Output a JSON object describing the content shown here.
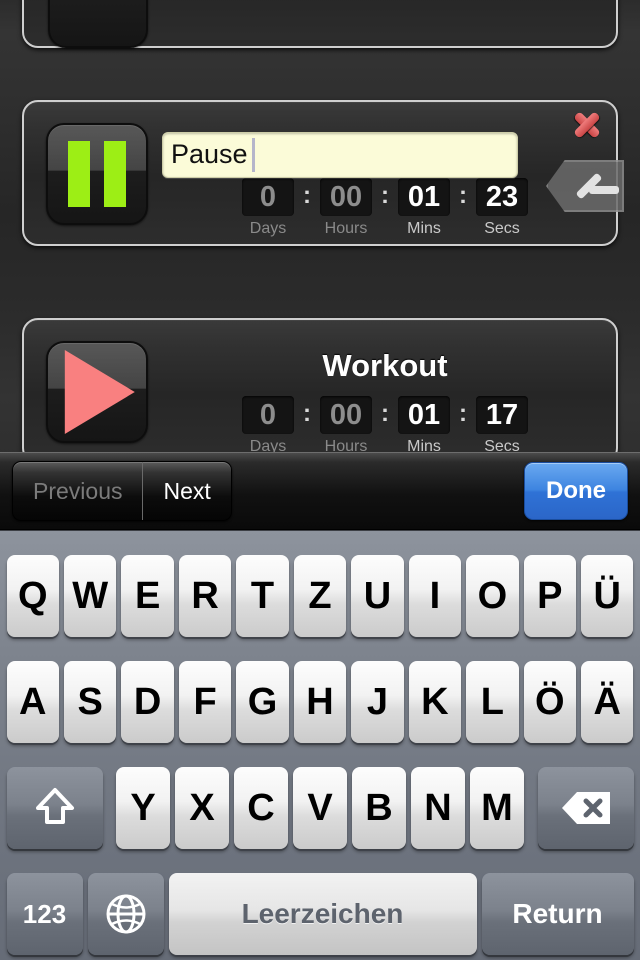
{
  "app": {
    "background_color": "#2a2a2a",
    "accent_green": "#9dee15",
    "accent_salmon": "#f98080",
    "accent_blue": "#3d84e0",
    "field_color": "#fbfbd8"
  },
  "timer_labels": {
    "days": "Days",
    "hours": "Hours",
    "mins": "Mins",
    "secs": "Secs"
  },
  "cards": [
    {
      "id": "card-cut-top",
      "title": "",
      "state_icon": "pause-icon",
      "visible": "partial",
      "time": {
        "days": "",
        "hours": "",
        "mins": "",
        "secs": ""
      }
    },
    {
      "id": "card-pause",
      "title": "Pause",
      "state_icon": "pause-icon",
      "editing": true,
      "input_value": "Pause",
      "input_placeholder": "",
      "time": {
        "days": "0",
        "hours": "00",
        "mins": "01",
        "secs": "23"
      },
      "delete_label": "×",
      "clear_label": "×"
    },
    {
      "id": "card-workout",
      "title": "Workout",
      "state_icon": "play-icon",
      "editing": false,
      "time": {
        "days": "0",
        "hours": "00",
        "mins": "01",
        "secs": "17"
      }
    }
  ],
  "accessory_toolbar": {
    "previous_label": "Previous",
    "previous_enabled": false,
    "next_label": "Next",
    "next_enabled": true,
    "done_label": "Done"
  },
  "keyboard": {
    "language": "German (QWERTZ)",
    "shift_state": "uppercase",
    "row1": [
      "Q",
      "W",
      "E",
      "R",
      "T",
      "Z",
      "U",
      "I",
      "O",
      "P",
      "Ü"
    ],
    "row2": [
      "A",
      "S",
      "D",
      "F",
      "G",
      "H",
      "J",
      "K",
      "L",
      "Ö",
      "Ä"
    ],
    "row3": [
      "Y",
      "X",
      "C",
      "V",
      "B",
      "N",
      "M"
    ],
    "shift_label": "shift-icon",
    "backspace_label": "backspace-icon",
    "numbers_label": "123",
    "globe_label": "globe-icon",
    "space_label": "Leerzeichen",
    "return_label": "Return"
  }
}
